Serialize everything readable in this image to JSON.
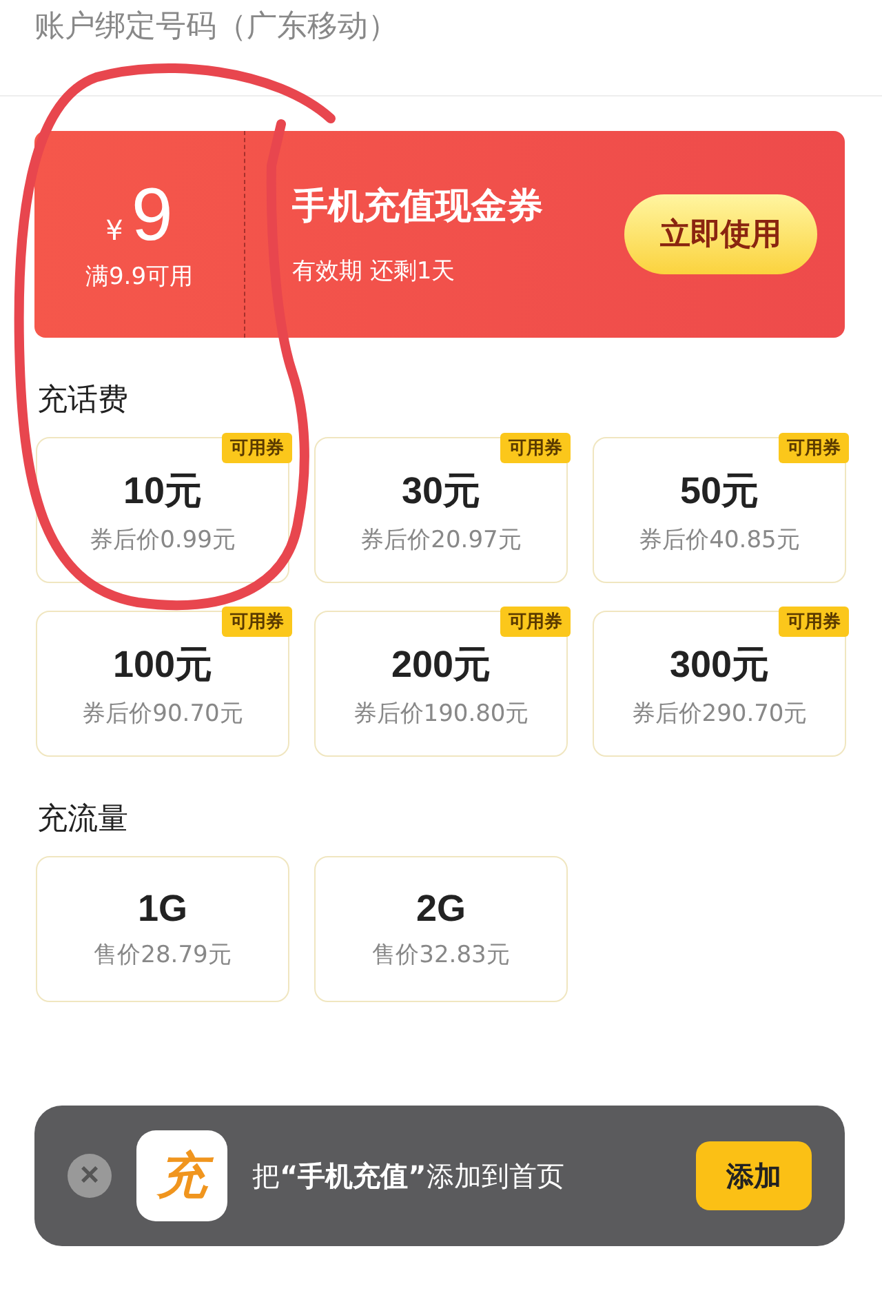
{
  "header": {
    "title": "账户绑定号码（广东移动）"
  },
  "coupon": {
    "currency": "¥",
    "amount": "9",
    "condition": "满9.9可用",
    "title": "手机充值现金券",
    "validity": "有效期 还剩1天",
    "button": "立即使用"
  },
  "sections": [
    {
      "title": "充话费",
      "cards": [
        {
          "value": "10元",
          "price": "券后价0.99元",
          "badge": "可用券"
        },
        {
          "value": "30元",
          "price": "券后价20.97元",
          "badge": "可用券"
        },
        {
          "value": "50元",
          "price": "券后价40.85元",
          "badge": "可用券"
        },
        {
          "value": "100元",
          "price": "券后价90.70元",
          "badge": "可用券"
        },
        {
          "value": "200元",
          "price": "券后价190.80元",
          "badge": "可用券"
        },
        {
          "value": "300元",
          "price": "券后价290.70元",
          "badge": "可用券"
        }
      ]
    },
    {
      "title": "充流量",
      "cards": [
        {
          "value": "1G",
          "price": "售价28.79元"
        },
        {
          "value": "2G",
          "price": "售价32.83元"
        }
      ]
    }
  ],
  "toast": {
    "close": "×",
    "app_icon": "充",
    "message": "把**“手机充值”**添加到首页",
    "button": "添加"
  },
  "annotation": {
    "kind": "circle"
  }
}
